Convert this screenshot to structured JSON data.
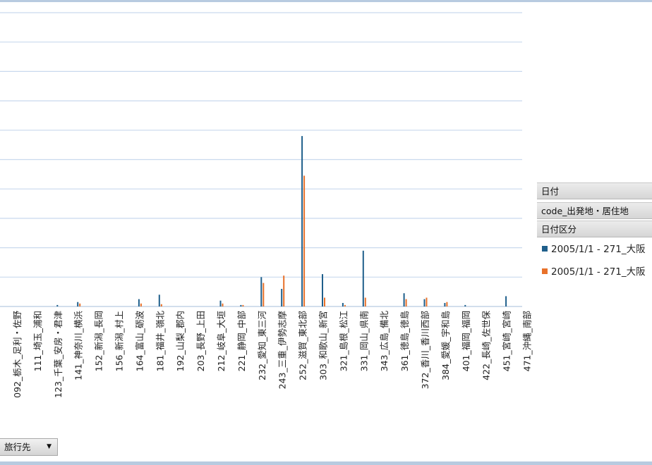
{
  "chart_data": {
    "type": "bar",
    "grid": true,
    "legend_position": "right",
    "ylim": [
      0,
      100
    ],
    "categories": [
      "092_栃木_足利・佐野",
      "111_埼玉_浦和",
      "123_千葉_安房・君津",
      "141_神奈川_横浜",
      "152_新潟_長岡",
      "156_新潟_村上",
      "164_富山_砺波",
      "181_福井_嶺北",
      "192_山梨_郡内",
      "203_長野_上田",
      "212_岐阜_大垣",
      "221_静岡_中部",
      "232_愛知_東三河",
      "243_三重_伊勢志摩",
      "252_滋賀_東北部",
      "303_和歌山_新宮",
      "321_島根_松江",
      "331_岡山_県南",
      "343_広島_備北",
      "361_徳島_徳島",
      "372_香川_香川西部",
      "384_愛媛_宇和島",
      "401_福岡_福岡",
      "422_長崎_佐世保",
      "451_宮崎_宮崎",
      "471_沖縄_南部"
    ],
    "series": [
      {
        "name": "2005/1/1 - 271_大阪",
        "color": "#1f5f8b",
        "values": [
          0,
          0,
          0.5,
          1.5,
          0,
          0,
          2.5,
          4,
          0,
          0,
          2,
          0.5,
          10,
          6,
          58,
          11,
          1.2,
          19,
          0,
          4.5,
          2.5,
          1.2,
          0.5,
          0,
          3.5,
          0
        ]
      },
      {
        "name": "2005/1/1 - 271_大阪",
        "color": "#e8712a",
        "values": [
          0,
          0,
          0,
          1,
          0,
          0,
          1,
          0.8,
          0,
          0,
          1,
          0.5,
          8,
          10.5,
          44.5,
          3,
          0.5,
          3,
          0,
          2.5,
          3,
          1.5,
          0,
          0,
          0,
          0
        ]
      }
    ]
  },
  "legend": {
    "field_date": "日付",
    "field_origin": "code_出発地・居住地",
    "field_date_type": "日付区分",
    "items": [
      "2005/1/1 - 271_大阪",
      "2005/1/1 - 271_大阪"
    ]
  },
  "axis_field": {
    "label": "旅行先"
  },
  "colors": {
    "series_1": "#1f5f8b",
    "series_2": "#e8712a",
    "grid": "#c9d9ee"
  }
}
